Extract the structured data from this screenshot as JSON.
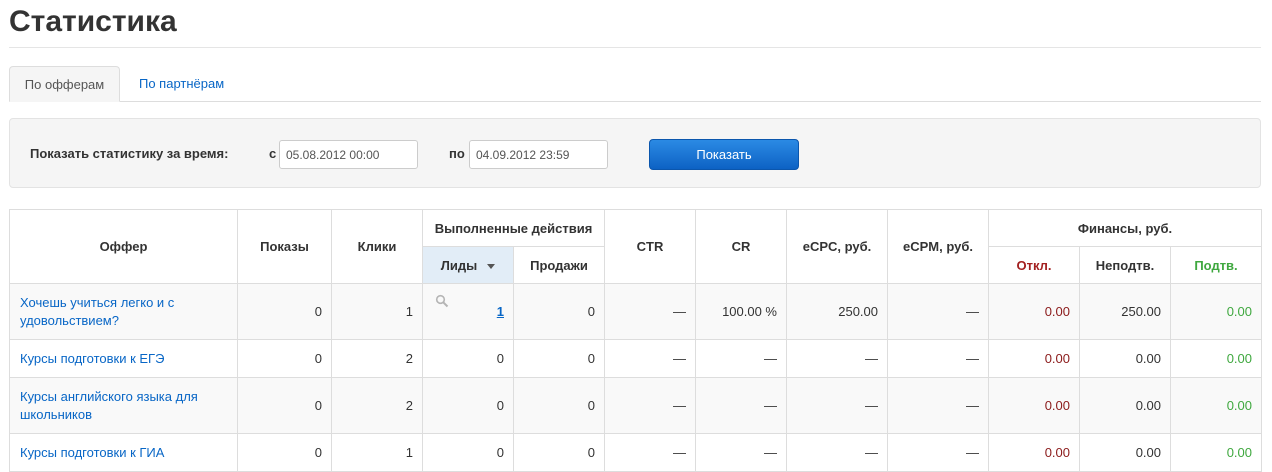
{
  "page": {
    "title": "Статистика"
  },
  "tabs": [
    {
      "label": "По офферам",
      "active": true
    },
    {
      "label": "По партнёрам",
      "active": false
    }
  ],
  "filter": {
    "label": "Показать статистику за время:",
    "from_label": "с",
    "from_value": "05.08.2012 00:00",
    "to_label": "по",
    "to_value": "04.09.2012 23:59",
    "button_label": "Показать"
  },
  "table": {
    "headers": {
      "offer": "Оффер",
      "impressions": "Показы",
      "clicks": "Клики",
      "actions": "Выполненные действия",
      "leads": "Лиды",
      "sales": "Продажи",
      "ctr": "CTR",
      "cr": "CR",
      "ecpc": "eCPC, руб.",
      "ecpm": "eCPM, руб.",
      "finance": "Финансы, руб.",
      "declined": "Откл.",
      "unconfirmed": "Неподтв.",
      "confirmed": "Подтв."
    },
    "rows": [
      {
        "offer": "Хочешь учиться легко и с удовольствием?",
        "impressions": "0",
        "clicks": "1",
        "leads": "1",
        "sales": "0",
        "ctr": "—",
        "cr": "100.00 %",
        "ecpc": "250.00",
        "ecpm": "—",
        "declined": "0.00",
        "unconfirmed": "250.00",
        "confirmed": "0.00"
      },
      {
        "offer": "Курсы подготовки к ЕГЭ",
        "impressions": "0",
        "clicks": "2",
        "leads": "0",
        "sales": "0",
        "ctr": "—",
        "cr": "—",
        "ecpc": "—",
        "ecpm": "—",
        "declined": "0.00",
        "unconfirmed": "0.00",
        "confirmed": "0.00"
      },
      {
        "offer": "Курсы английского языка для школьников",
        "impressions": "0",
        "clicks": "2",
        "leads": "0",
        "sales": "0",
        "ctr": "—",
        "cr": "—",
        "ecpc": "—",
        "ecpm": "—",
        "declined": "0.00",
        "unconfirmed": "0.00",
        "confirmed": "0.00"
      },
      {
        "offer": "Курсы подготовки к ГИА",
        "impressions": "0",
        "clicks": "1",
        "leads": "0",
        "sales": "0",
        "ctr": "—",
        "cr": "—",
        "ecpc": "—",
        "ecpm": "—",
        "declined": "0.00",
        "unconfirmed": "0.00",
        "confirmed": "0.00"
      }
    ]
  },
  "colors": {
    "link": "#0866c6",
    "button": "#1a73d1",
    "declined": "#8b1a1a",
    "confirmed": "#3fa83f"
  }
}
